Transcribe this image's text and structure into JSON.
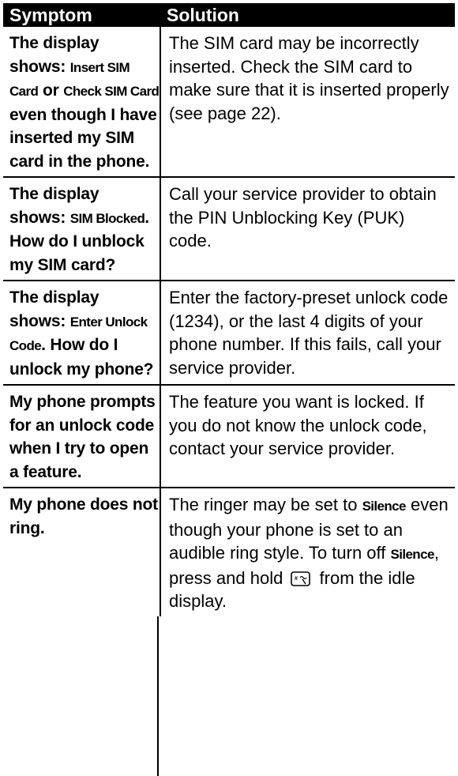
{
  "table": {
    "headers": {
      "symptom": "Symptom",
      "solution": "Solution"
    },
    "rows": [
      {
        "symptom": [
          "The display shows: ",
          {
            "display": "Insert SIM Card"
          },
          " or ",
          {
            "display": "Check SIM Card"
          },
          " even though I have inserted my SIM card in the phone."
        ],
        "solution": [
          "The SIM card may be incorrectly inserted. Check the SIM card to make sure that it is inserted properly (see page 22)."
        ]
      },
      {
        "symptom": [
          "The display shows: ",
          {
            "display": "SIM Blocked"
          },
          ". How do I unblock my SIM card?"
        ],
        "solution": [
          "Call your service provider to obtain the PIN Unblocking Key (PUK) code."
        ]
      },
      {
        "symptom": [
          "The display shows: ",
          {
            "display": "Enter Unlock Code"
          },
          ". How do I unlock my phone?"
        ],
        "solution": [
          "Enter the factory-preset unlock code (1234), or the last 4 digits of your phone number. If this fails, call your service provider."
        ]
      },
      {
        "symptom": [
          "My phone prompts for an unlock code when I try to open a feature."
        ],
        "solution": [
          "The feature you want is locked. If you do not know the unlock code, contact your service provider."
        ]
      },
      {
        "symptom": [
          "My phone does not ring."
        ],
        "solution": [
          "The ringer may be set to ",
          {
            "display": "Silence"
          },
          " even though your phone is set to an audible ring style. To turn off ",
          {
            "display": "Silence"
          },
          ", press and hold ",
          {
            "icon": "silence-key-icon"
          },
          " from the idle display."
        ]
      }
    ]
  }
}
